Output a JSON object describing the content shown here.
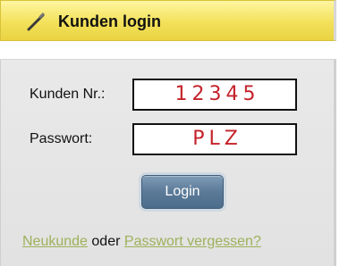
{
  "header": {
    "title": "Kunden login",
    "icon": "pencil-icon"
  },
  "form": {
    "customer_number_label": "Kunden Nr.:",
    "customer_number_value": "12345",
    "password_label": "Passwort:",
    "password_value": "PLZ",
    "login_label": "Login"
  },
  "footer": {
    "new_customer_link": "Neukunde",
    "separator": "oder",
    "forgot_password_link": "Passwort vergessen?"
  },
  "colors": {
    "header_bg": "#f3e15a",
    "field_text": "#c4222a",
    "button_bg": "#5b7a98",
    "link": "#9db15a"
  }
}
